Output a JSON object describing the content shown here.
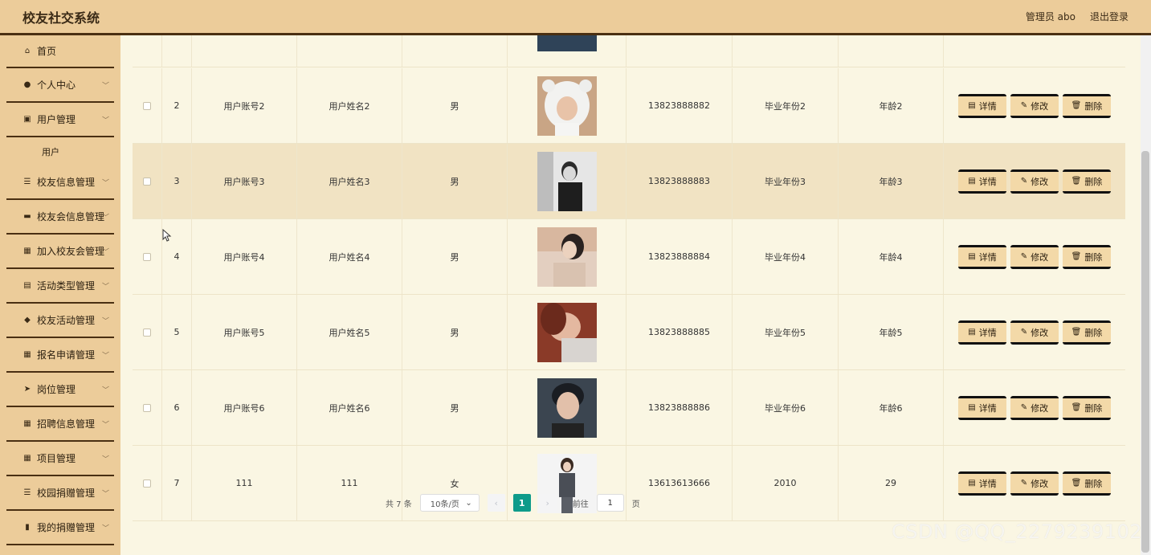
{
  "app": {
    "title": "校友社交系统"
  },
  "header": {
    "user": "管理员 abo",
    "logout": "退出登录"
  },
  "sidebar": {
    "items": [
      {
        "label": "首页",
        "icon": "home-icon"
      },
      {
        "label": "个人中心",
        "icon": "user-icon"
      },
      {
        "label": "用户管理",
        "icon": "chart-icon",
        "sub": [
          "用户"
        ]
      },
      {
        "label": "校友信息管理",
        "icon": "sliders-icon"
      },
      {
        "label": "校友会信息管理",
        "icon": "briefcase-icon"
      },
      {
        "label": "加入校友会管理",
        "icon": "grid-icon"
      },
      {
        "label": "活动类型管理",
        "icon": "clipboard-icon"
      },
      {
        "label": "校友活动管理",
        "icon": "thumbs-up-icon"
      },
      {
        "label": "报名申请管理",
        "icon": "grid-icon"
      },
      {
        "label": "岗位管理",
        "icon": "send-icon"
      },
      {
        "label": "招聘信息管理",
        "icon": "grid-icon"
      },
      {
        "label": "项目管理",
        "icon": "grid-icon"
      },
      {
        "label": "校园捐赠管理",
        "icon": "sliders-icon"
      },
      {
        "label": "我的捐赠管理",
        "icon": "bar-chart-icon"
      }
    ]
  },
  "rows": [
    {
      "index": "2",
      "account": "用户账号2",
      "name": "用户姓名2",
      "gender": "男",
      "phone": "13823888882",
      "year": "毕业年份2",
      "age": "年龄2"
    },
    {
      "index": "3",
      "account": "用户账号3",
      "name": "用户姓名3",
      "gender": "男",
      "phone": "13823888883",
      "year": "毕业年份3",
      "age": "年龄3"
    },
    {
      "index": "4",
      "account": "用户账号4",
      "name": "用户姓名4",
      "gender": "男",
      "phone": "13823888884",
      "year": "毕业年份4",
      "age": "年龄4"
    },
    {
      "index": "5",
      "account": "用户账号5",
      "name": "用户姓名5",
      "gender": "男",
      "phone": "13823888885",
      "year": "毕业年份5",
      "age": "年龄5"
    },
    {
      "index": "6",
      "account": "用户账号6",
      "name": "用户姓名6",
      "gender": "男",
      "phone": "13823888886",
      "year": "毕业年份6",
      "age": "年龄6"
    },
    {
      "index": "7",
      "account": "111",
      "name": "111",
      "gender": "女",
      "phone": "13613613666",
      "year": "2010",
      "age": "29"
    }
  ],
  "actions": {
    "detail": "详情",
    "edit": "修改",
    "delete": "删除"
  },
  "pager": {
    "total": "共 7 条",
    "size": "10条/页",
    "current": "1",
    "goto": "前往",
    "goto_value": "1",
    "page_unit": "页"
  },
  "watermark": "CSDN @QQ_2279239102",
  "colors": {
    "header": "#eccc9a",
    "highlight_row": "#f1e3c3",
    "page_active": "#0e9b8a"
  }
}
